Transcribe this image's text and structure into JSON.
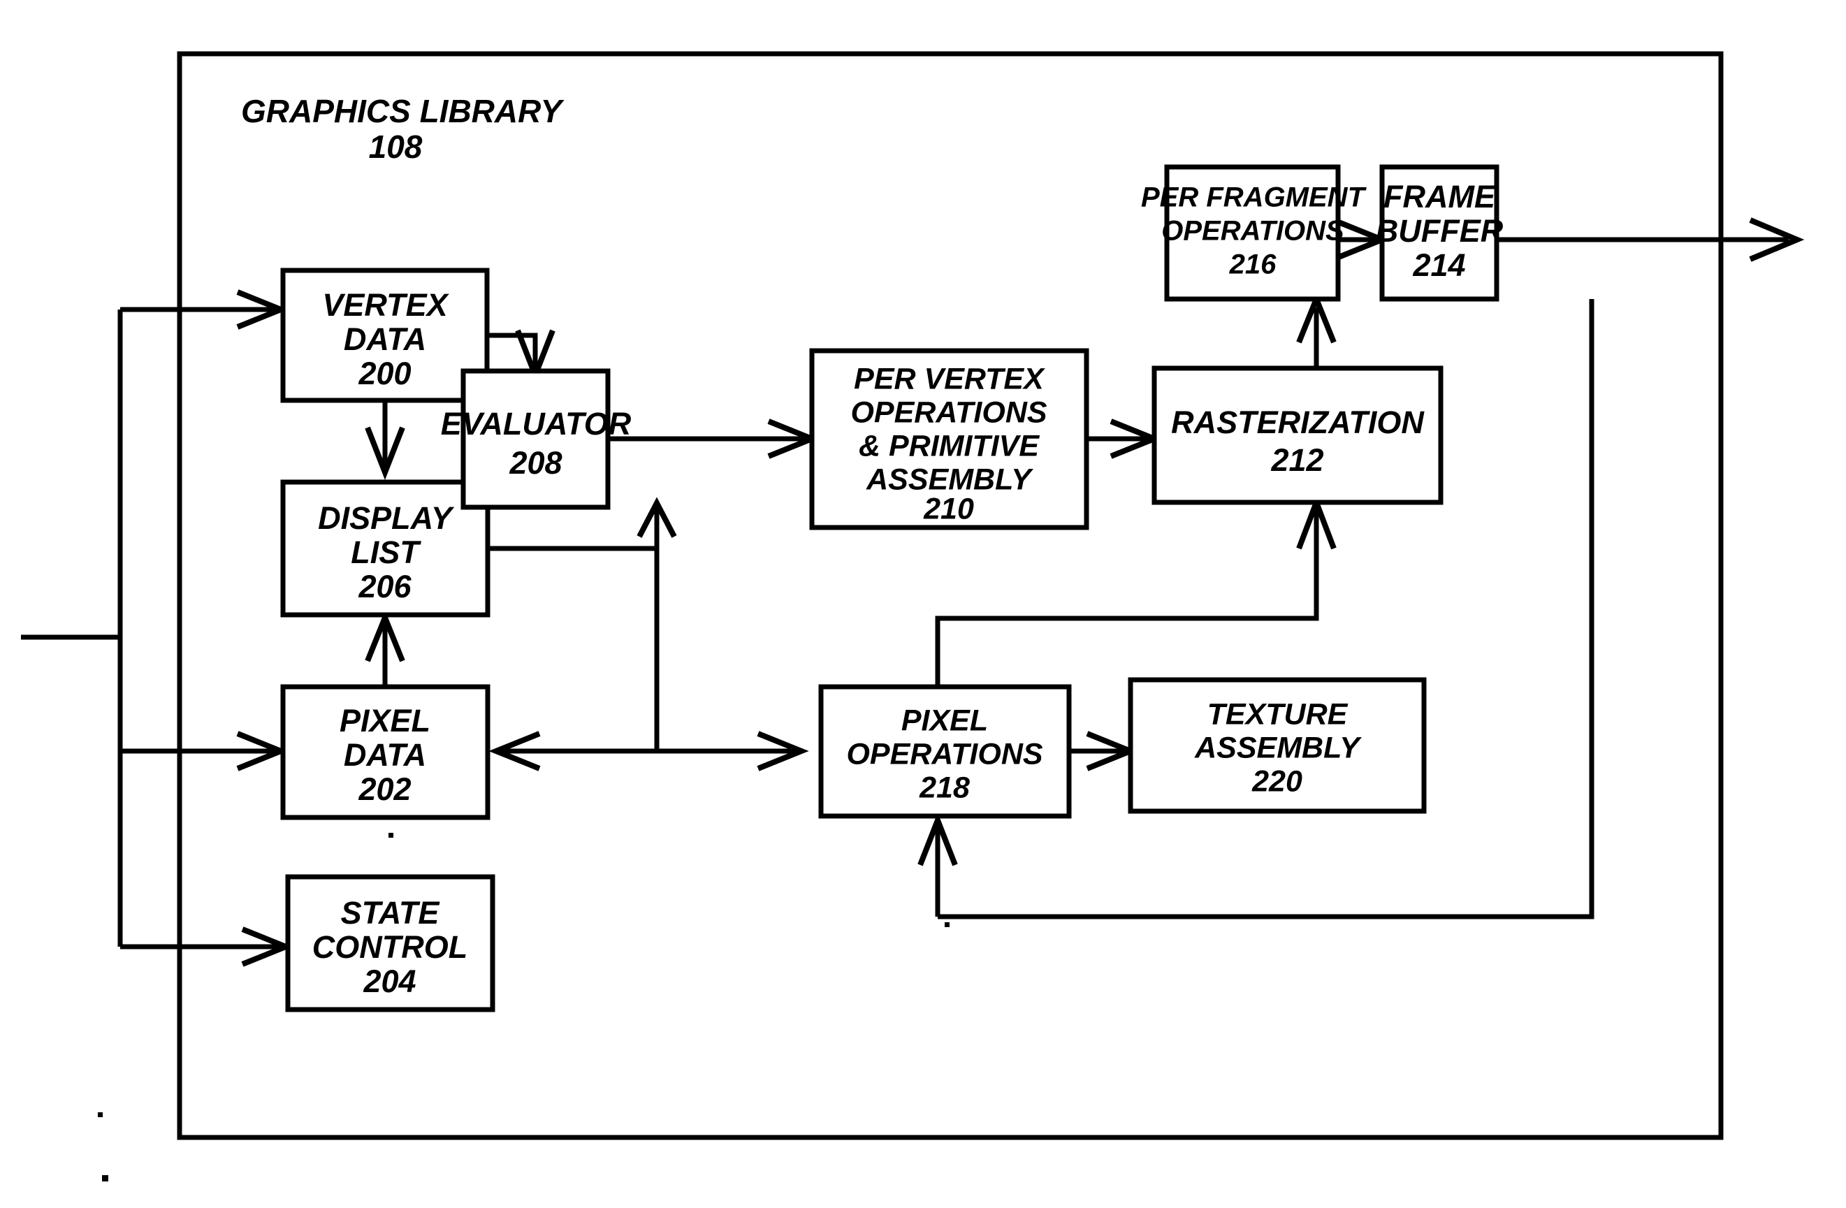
{
  "figure": {
    "title": "GRAPHICS LIBRARY",
    "title_number": "108",
    "background_color": "#ffffff",
    "line_color": "#000000"
  },
  "blocks": [
    {
      "id": "vertex_data",
      "lines": [
        "VERTEX",
        "DATA"
      ],
      "number": "200"
    },
    {
      "id": "display_list",
      "lines": [
        "DISPLAY",
        "LIST"
      ],
      "number": "206"
    },
    {
      "id": "pixel_data",
      "lines": [
        "PIXEL",
        "DATA"
      ],
      "number": "202"
    },
    {
      "id": "state_control",
      "lines": [
        "STATE",
        "CONTROL"
      ],
      "number": "204"
    },
    {
      "id": "evaluator",
      "lines": [
        "EVALUATOR"
      ],
      "number": "208"
    },
    {
      "id": "per_vertex_ops",
      "lines": [
        "PER VERTEX",
        "OPERATIONS",
        "& PRIMITIVE",
        "ASSEMBLY"
      ],
      "number": "210"
    },
    {
      "id": "rasterization",
      "lines": [
        "RASTERIZATION"
      ],
      "number": "212"
    },
    {
      "id": "per_fragment_ops",
      "lines": [
        "PER FRAGMENT",
        "OPERATIONS"
      ],
      "number": "216"
    },
    {
      "id": "frame_buffer",
      "lines": [
        "FRAME",
        "BUFFER"
      ],
      "number": "214"
    },
    {
      "id": "pixel_operations",
      "lines": [
        "PIXEL",
        "OPERATIONS"
      ],
      "number": "218"
    },
    {
      "id": "texture_assembly",
      "lines": [
        "TEXTURE",
        "ASSEMBLY"
      ],
      "number": "220"
    }
  ],
  "labels": {
    "vertex_data_l1": "VERTEX",
    "vertex_data_l2": "DATA",
    "vertex_data_num": "200",
    "display_list_l1": "DISPLAY",
    "display_list_l2": "LIST",
    "display_list_num": "206",
    "pixel_data_l1": "PIXEL",
    "pixel_data_l2": "DATA",
    "pixel_data_num": "202",
    "state_control_l1": "STATE",
    "state_control_l2": "CONTROL",
    "state_control_num": "204",
    "evaluator_l1": "EVALUATOR",
    "evaluator_num": "208",
    "per_vertex_l1": "PER VERTEX",
    "per_vertex_l2": "OPERATIONS",
    "per_vertex_l3": "& PRIMITIVE",
    "per_vertex_l4": "ASSEMBLY",
    "per_vertex_num": "210",
    "rasterization_l1": "RASTERIZATION",
    "rasterization_num": "212",
    "per_fragment_l1": "PER FRAGMENT",
    "per_fragment_l2": "OPERATIONS",
    "per_fragment_num": "216",
    "frame_buffer_l1": "FRAME",
    "frame_buffer_l2": "BUFFER",
    "frame_buffer_num": "214",
    "pixel_ops_l1": "PIXEL",
    "pixel_ops_l2": "OPERATIONS",
    "pixel_ops_num": "218",
    "texture_l1": "TEXTURE",
    "texture_l2": "ASSEMBLY",
    "texture_num": "220",
    "graphics_library": "GRAPHICS LIBRARY",
    "graphics_library_num": "108"
  },
  "connections": [
    {
      "from": "input-bus",
      "to": "vertex_data",
      "style": "arrow"
    },
    {
      "from": "input-bus",
      "to": "pixel_data",
      "style": "arrow"
    },
    {
      "from": "input-bus",
      "to": "state_control",
      "style": "arrow"
    },
    {
      "from": "vertex_data",
      "to": "display_list",
      "style": "arrow"
    },
    {
      "from": "vertex_data",
      "to": "evaluator",
      "style": "arrow"
    },
    {
      "from": "display_list",
      "to": "evaluator",
      "style": "arrow"
    },
    {
      "from": "pixel_data",
      "to": "display_list",
      "style": "arrow"
    },
    {
      "from": "evaluator",
      "to": "per_vertex_ops",
      "style": "arrow"
    },
    {
      "from": "evaluator",
      "to": "pixel_data",
      "style": "arrow"
    },
    {
      "from": "per_vertex_ops",
      "to": "rasterization",
      "style": "arrow"
    },
    {
      "from": "rasterization",
      "to": "per_fragment_ops",
      "style": "arrow"
    },
    {
      "from": "per_fragment_ops",
      "to": "frame_buffer",
      "style": "arrow"
    },
    {
      "from": "frame_buffer",
      "to": "output",
      "style": "arrow"
    },
    {
      "from": "frame_buffer",
      "to": "pixel_operations",
      "style": "arrow"
    },
    {
      "from": "pixel_operations",
      "to": "texture_assembly",
      "style": "arrow"
    },
    {
      "from": "pixel_operations",
      "to": "rasterization",
      "style": "arrow"
    },
    {
      "from": "pixel_operations",
      "to": "pixel_data",
      "style": "arrow"
    }
  ]
}
